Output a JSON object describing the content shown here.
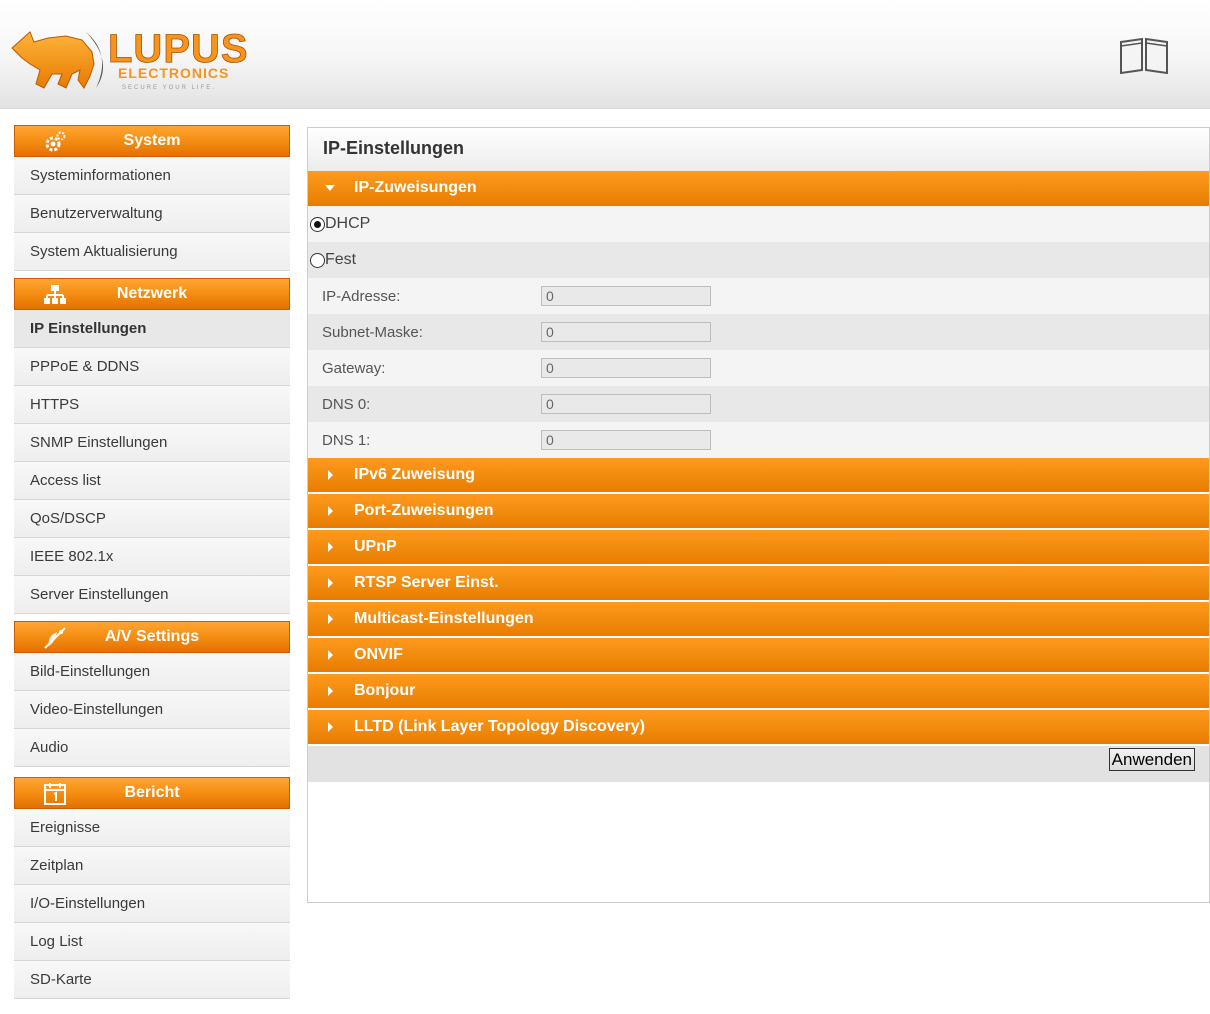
{
  "header": {
    "logo_brand": "LUPUS",
    "logo_sub": "ELECTRONICS",
    "logo_tagline": "SECURE YOUR LIFE.",
    "icon": "browser-window-icon"
  },
  "sidebar": {
    "categories": [
      {
        "label": "System",
        "icon": "gears-icon",
        "items": [
          "Systeminformationen",
          "Benutzerverwaltung",
          "System Aktualisierung"
        ]
      },
      {
        "label": "Netzwerk",
        "icon": "network-icon",
        "items": [
          "IP Einstellungen",
          "PPPoE & DDNS",
          "HTTPS",
          "SNMP Einstellungen",
          "Access list",
          "QoS/DSCP",
          "IEEE 802.1x",
          "Server Einstellungen"
        ]
      },
      {
        "label": "A/V Settings",
        "icon": "satellite-dish-icon",
        "items": [
          "Bild-Einstellungen",
          "Video-Einstellungen",
          "Audio"
        ]
      },
      {
        "label": "Bericht",
        "icon": "calendar-icon",
        "items": [
          "Ereignisse",
          "Zeitplan",
          "I/O-Einstellungen",
          "Log List",
          "SD-Karte"
        ]
      }
    ],
    "active_item": "IP Einstellungen"
  },
  "main": {
    "title": "IP-Einstellungen",
    "open_section": "IP-Zuweisungen",
    "radio_options": [
      {
        "label": "DHCP",
        "checked": true
      },
      {
        "label": "Fest",
        "checked": false
      }
    ],
    "fields": [
      {
        "label": "IP-Adresse:",
        "value": "0"
      },
      {
        "label": "Subnet-Maske:",
        "value": "0"
      },
      {
        "label": "Gateway:",
        "value": "0"
      },
      {
        "label": "DNS 0:",
        "value": "0"
      },
      {
        "label": "DNS 1:",
        "value": "0"
      }
    ],
    "collapsed_sections": [
      "IPv6 Zuweisung",
      "Port-Zuweisungen",
      "UPnP",
      "RTSP Server Einst.",
      "Multicast-Einstellungen",
      "ONVIF",
      "Bonjour",
      "LLTD (Link Layer Topology Discovery)"
    ],
    "apply_label": "Anwenden"
  },
  "colors": {
    "accent_orange": "#f28c0f",
    "logo_orange": "#f7941d"
  }
}
